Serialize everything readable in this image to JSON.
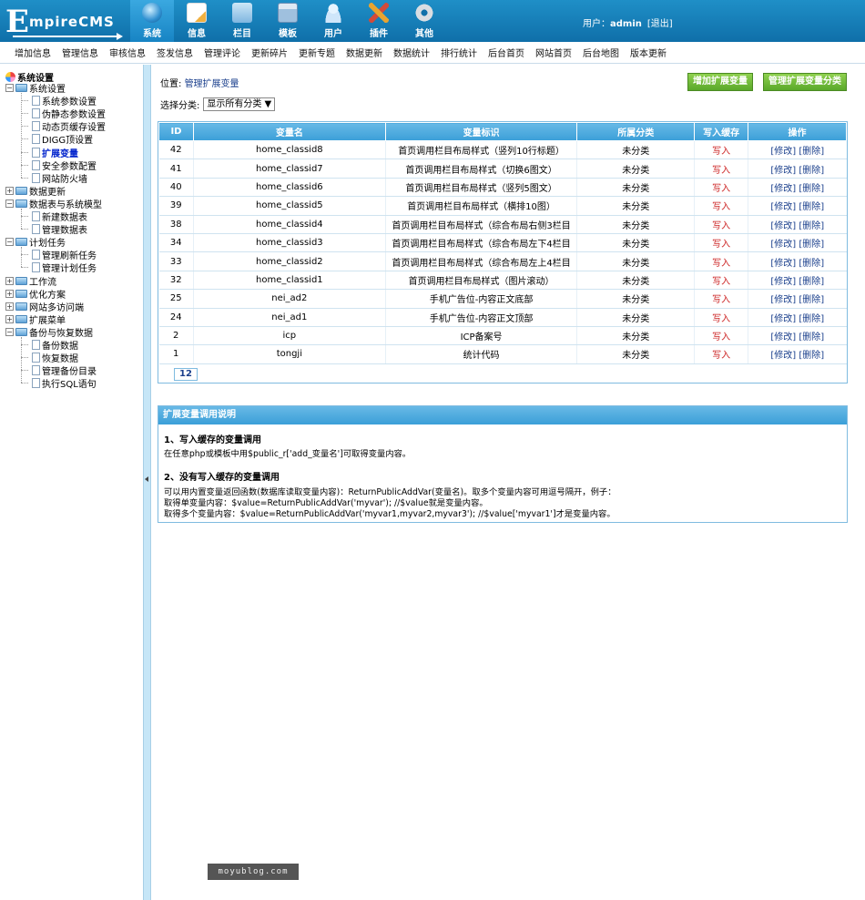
{
  "app": {
    "logo_e": "E",
    "logo_rest": "mpireCMS"
  },
  "nav": {
    "tabs": [
      {
        "label": "系统",
        "icon": "globe-icon",
        "active": true
      },
      {
        "label": "信息",
        "icon": "document-icon"
      },
      {
        "label": "栏目",
        "icon": "folder-icon"
      },
      {
        "label": "模板",
        "icon": "window-icon"
      },
      {
        "label": "用户",
        "icon": "user-icon"
      },
      {
        "label": "插件",
        "icon": "tools-icon"
      },
      {
        "label": "其他",
        "icon": "gear-icon"
      }
    ],
    "user_prefix": "用户：",
    "user_name": "admin",
    "logout": "[退出]"
  },
  "submenu": [
    "增加信息",
    "管理信息",
    "审核信息",
    "签发信息",
    "管理评论",
    "更新碎片",
    "更新专题",
    "数据更新",
    "数据统计",
    "排行统计",
    "后台首页",
    "网站首页",
    "后台地图",
    "版本更新"
  ],
  "tree": {
    "root": "系统设置",
    "nodes": [
      {
        "label": "系统设置",
        "level": 1,
        "type": "folder",
        "pm": "-"
      },
      {
        "label": "系统参数设置",
        "level": 2,
        "type": "page"
      },
      {
        "label": "伪静态参数设置",
        "level": 2,
        "type": "page"
      },
      {
        "label": "动态页缓存设置",
        "level": 2,
        "type": "page"
      },
      {
        "label": "DIGG顶设置",
        "level": 2,
        "type": "page"
      },
      {
        "label": "扩展变量",
        "level": 2,
        "type": "page",
        "current": true
      },
      {
        "label": "安全参数配置",
        "level": 2,
        "type": "page"
      },
      {
        "label": "网站防火墙",
        "level": 2,
        "type": "page"
      },
      {
        "label": "数据更新",
        "level": 1,
        "type": "folder",
        "pm": "+"
      },
      {
        "label": "数据表与系统模型",
        "level": 1,
        "type": "folder",
        "pm": "-"
      },
      {
        "label": "新建数据表",
        "level": 2,
        "type": "page"
      },
      {
        "label": "管理数据表",
        "level": 2,
        "type": "page"
      },
      {
        "label": "计划任务",
        "level": 1,
        "type": "folder",
        "pm": "-"
      },
      {
        "label": "管理刷新任务",
        "level": 2,
        "type": "page"
      },
      {
        "label": "管理计划任务",
        "level": 2,
        "type": "page"
      },
      {
        "label": "工作流",
        "level": 1,
        "type": "folder",
        "pm": "+"
      },
      {
        "label": "优化方案",
        "level": 1,
        "type": "folder",
        "pm": "+"
      },
      {
        "label": "网站多访问端",
        "level": 1,
        "type": "folder",
        "pm": "+"
      },
      {
        "label": "扩展菜单",
        "level": 1,
        "type": "folder",
        "pm": "+"
      },
      {
        "label": "备份与恢复数据",
        "level": 1,
        "type": "folder",
        "pm": "-"
      },
      {
        "label": "备份数据",
        "level": 2,
        "type": "page"
      },
      {
        "label": "恢复数据",
        "level": 2,
        "type": "page"
      },
      {
        "label": "管理备份目录",
        "level": 2,
        "type": "page"
      },
      {
        "label": "执行SQL语句",
        "level": 2,
        "type": "page"
      }
    ]
  },
  "main": {
    "crumb_prefix": "位置: ",
    "crumb_link": "管理扩展变量",
    "btn_add": "增加扩展变量",
    "btn_manage": "管理扩展变量分类",
    "filter_label": "选择分类:",
    "filter_value": "显示所有分类 ▼",
    "table": {
      "headers": [
        "ID",
        "变量名",
        "变量标识",
        "所属分类",
        "写入缓存",
        "操作"
      ],
      "rows": [
        [
          "42",
          "home_classid8",
          "首页调用栏目布局样式（竖列10行标题）",
          "未分类",
          "写入"
        ],
        [
          "41",
          "home_classid7",
          "首页调用栏目布局样式（切换6图文）",
          "未分类",
          "写入"
        ],
        [
          "40",
          "home_classid6",
          "首页调用栏目布局样式（竖列5图文）",
          "未分类",
          "写入"
        ],
        [
          "39",
          "home_classid5",
          "首页调用栏目布局样式（横排10图）",
          "未分类",
          "写入"
        ],
        [
          "38",
          "home_classid4",
          "首页调用栏目布局样式（综合布局右侧3栏目",
          "未分类",
          "写入"
        ],
        [
          "34",
          "home_classid3",
          "首页调用栏目布局样式（综合布局左下4栏目",
          "未分类",
          "写入"
        ],
        [
          "33",
          "home_classid2",
          "首页调用栏目布局样式（综合布局左上4栏目",
          "未分类",
          "写入"
        ],
        [
          "32",
          "home_classid1",
          "首页调用栏目布局样式（图片滚动）",
          "未分类",
          "写入"
        ],
        [
          "25",
          "nei_ad2",
          "手机广告位-内容正文底部",
          "未分类",
          "写入"
        ],
        [
          "24",
          "nei_ad1",
          "手机广告位-内容正文顶部",
          "未分类",
          "写入"
        ],
        [
          "2",
          "icp",
          "ICP备案号",
          "未分类",
          "写入"
        ],
        [
          "1",
          "tongji",
          "统计代码",
          "未分类",
          "写入"
        ]
      ],
      "op_edit": "[修改]",
      "op_delete": "[删除]"
    },
    "pager": "12",
    "info": {
      "title": "扩展变量调用说明",
      "h1": "1、写入缓存的变量调用",
      "p1": "在任意php或模板中用$public_r['add_变量名']可取得变量内容。",
      "h2": "2、没有写入缓存的变量调用",
      "p2a": "可以用内置变量返回函数(数据库读取变量内容)：ReturnPublicAddVar(变量名)。取多个变量内容可用逗号隔开，例子：",
      "p2b": "取得单变量内容：$value=ReturnPublicAddVar('myvar'); //$value就是变量内容。",
      "p2c": "取得多个变量内容：$value=ReturnPublicAddVar('myvar1,myvar2,myvar3'); //$value['myvar1']才是变量内容。"
    }
  },
  "watermark": "moyublog.com"
}
